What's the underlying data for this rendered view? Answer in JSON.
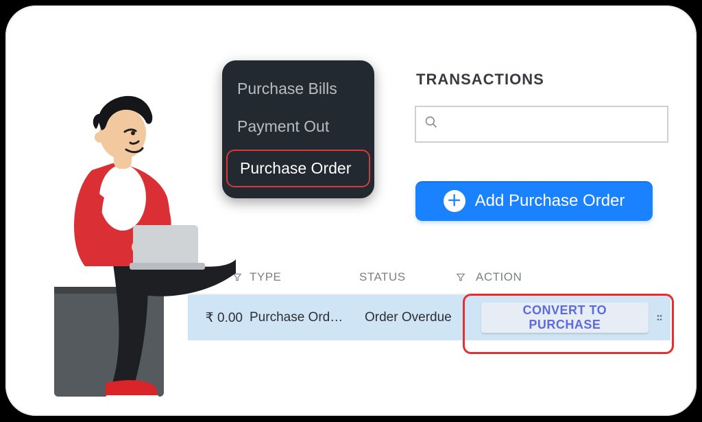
{
  "menu": {
    "items": [
      {
        "label": "Purchase Bills",
        "active": false
      },
      {
        "label": "Payment Out",
        "active": false
      },
      {
        "label": "Purchase Order",
        "active": true
      }
    ]
  },
  "panel": {
    "heading": "TRANSACTIONS",
    "search_placeholder": "",
    "add_label": "Add Purchase Order"
  },
  "table": {
    "headers": {
      "amount_filter": "filter",
      "type": "TYPE",
      "status": "STATUS",
      "status_filter": "filter",
      "action": "ACTION"
    },
    "rows": [
      {
        "amount": "₹ 0.00",
        "type": "Purchase Ord…",
        "status": "Order Overdue",
        "status_color": "#ec9a2d",
        "action_label": "CONVERT TO PURCHASE"
      }
    ]
  },
  "colors": {
    "primary": "#1a82ff",
    "menu_bg": "#232930",
    "highlight_red": "#e22f2f",
    "row_bg": "#cfe4f4",
    "status_warn": "#ec9a2d",
    "action_text": "#5d6bdc"
  }
}
